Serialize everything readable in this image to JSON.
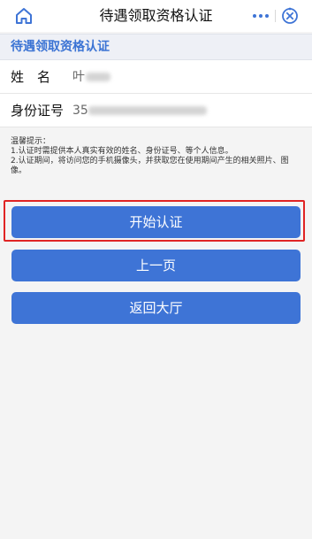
{
  "header": {
    "title": "待遇领取资格认证"
  },
  "section": {
    "title": "待遇领取资格认证"
  },
  "fields": {
    "name_label": "姓　名",
    "name_value": "叶",
    "id_label": "身份证号",
    "id_value": "35"
  },
  "tips": {
    "heading": "温馨提示：",
    "line1": "1.认证时需提供本人真实有效的姓名、身份证号、等个人信息。",
    "line2": "2.认证期间，将访问您的手机摄像头，并获取您在使用期间产生的相关照片、图像。"
  },
  "buttons": {
    "start": "开始认证",
    "previous": "上一页",
    "back_hall": "返回大厅"
  },
  "colors": {
    "accent": "#3e74d6",
    "section_title": "#3c74d4",
    "highlight": "#e02424"
  },
  "icons": {
    "home": "home-icon",
    "more": "more-icon",
    "close": "close-icon"
  }
}
